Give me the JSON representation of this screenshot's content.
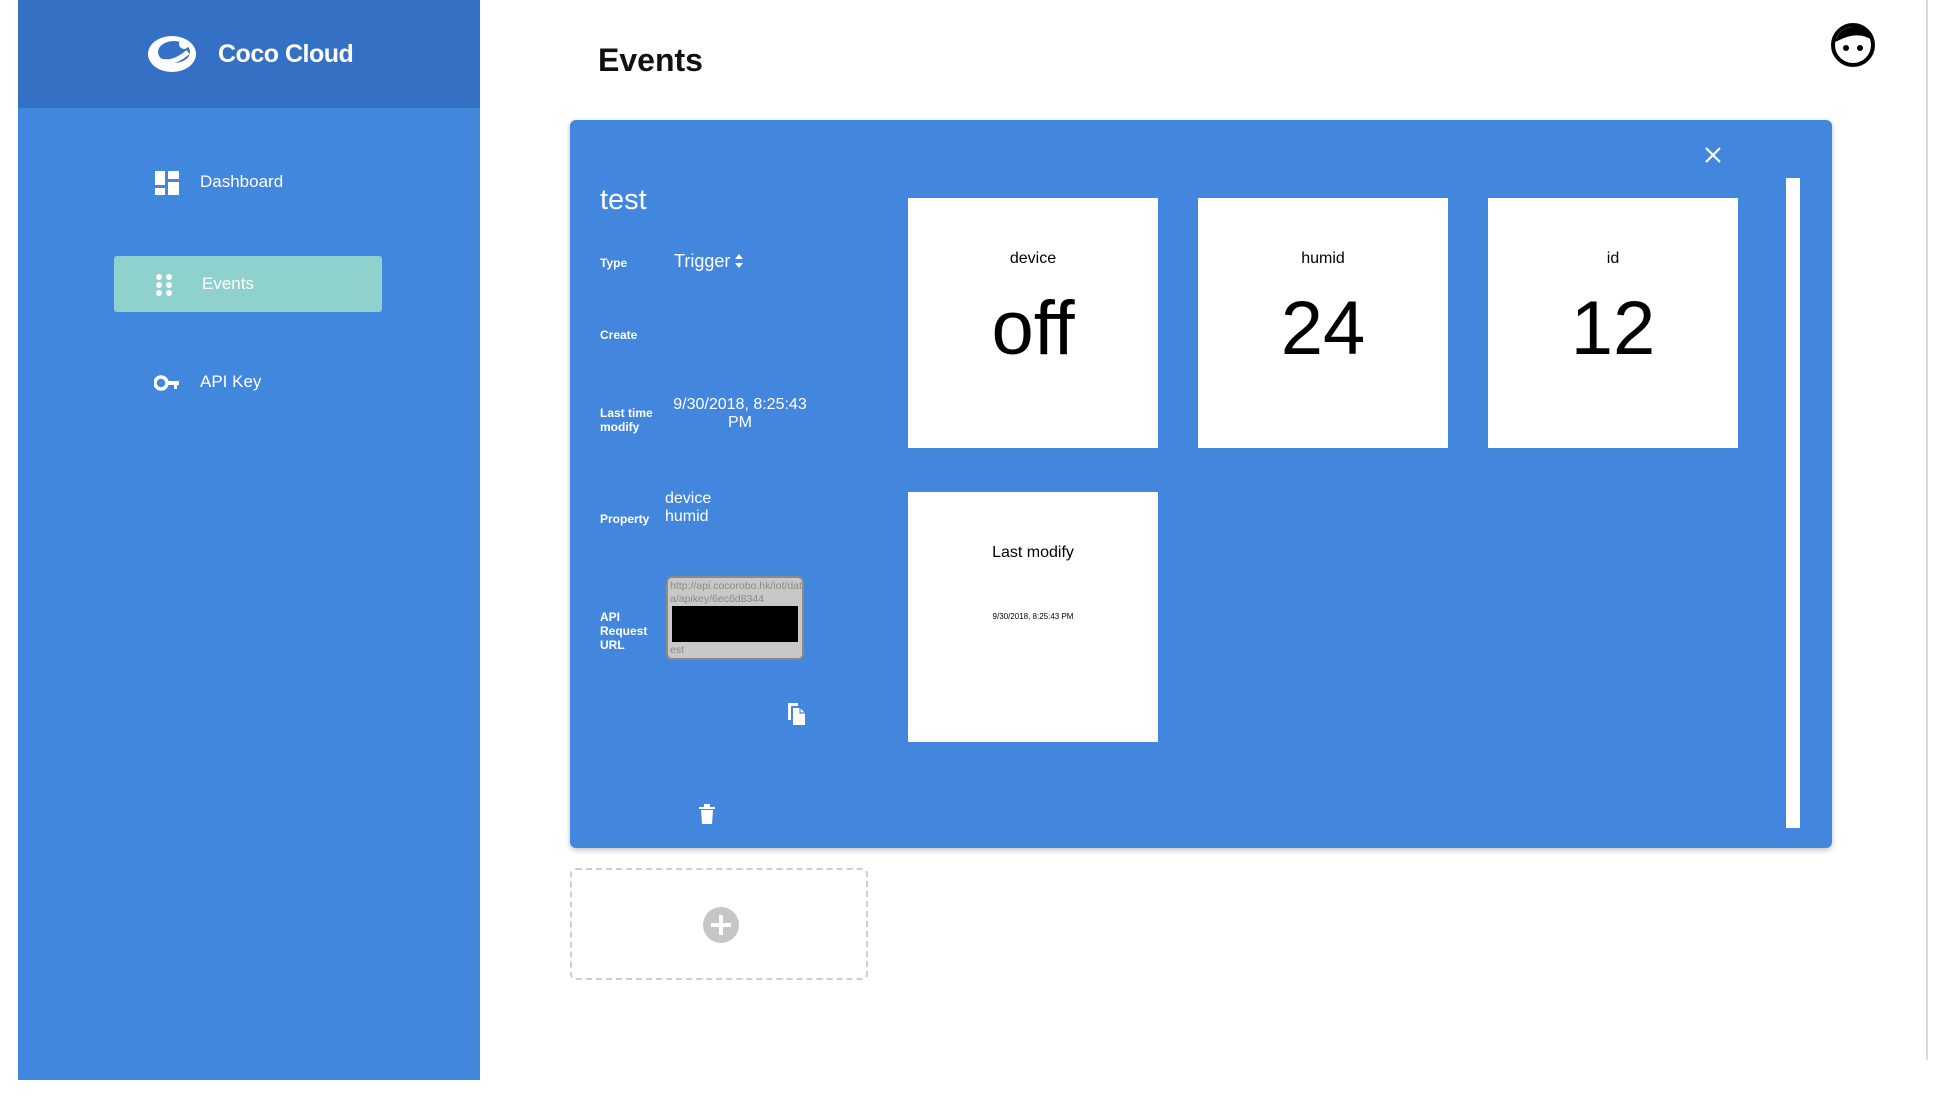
{
  "app": {
    "name": "Coco Cloud"
  },
  "sidebar": {
    "items": [
      {
        "label": "Dashboard",
        "icon": "dashboard-icon",
        "active": false
      },
      {
        "label": "Events",
        "icon": "dots-grid-icon",
        "active": true
      },
      {
        "label": "API Key",
        "icon": "key-icon",
        "active": false
      }
    ]
  },
  "header": {
    "title": "Events",
    "avatar_icon": "user-face-icon"
  },
  "event": {
    "name": "test",
    "type_label": "Type",
    "type_value": "Trigger",
    "create_label": "Create",
    "modify_label": "Last time modify",
    "modify_value": "9/30/2018, 8:25:43 PM",
    "property_label": "Property",
    "properties": [
      "device",
      "humid"
    ],
    "url_label": "API Request URL",
    "url_value": "http://api.cocorobo.hk/iot/data/apikey/6ec6d8344",
    "url_tail": "est"
  },
  "tiles": [
    {
      "label": "device",
      "value": "off"
    },
    {
      "label": "humid",
      "value": "24"
    },
    {
      "label": "id",
      "value": "12"
    },
    {
      "label": "Last modify",
      "value": "9/30/2018, 8:25:43 PM"
    }
  ],
  "colors": {
    "sidebar": "#4287de",
    "brand_bar": "#3471c4",
    "active_nav": "#8fd1cd",
    "card": "#4286de"
  }
}
